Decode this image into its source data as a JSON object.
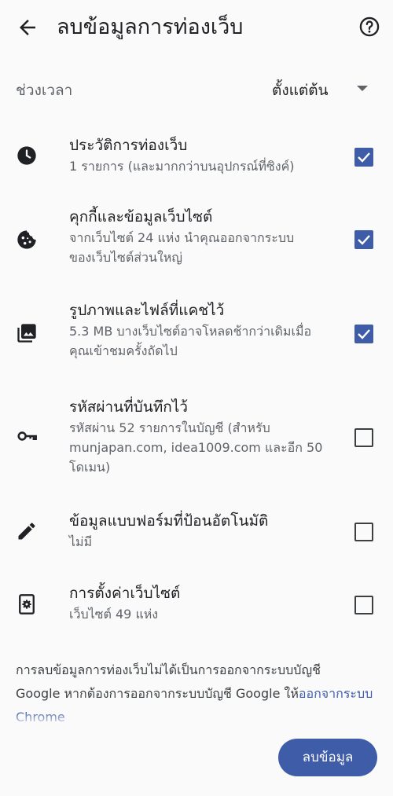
{
  "appbar": {
    "title": "ลบข้อมูลการท่องเว็บ",
    "back_icon": "arrow-back-icon",
    "help_icon": "help-circle-icon"
  },
  "time_range": {
    "label": "ช่วงเวลา",
    "value": "ตั้งแต่ต้น"
  },
  "items": [
    {
      "title": "ประวัติการท่องเว็บ",
      "subtitle": "1 รายการ (และมากกว่าบนอุปกรณ์ที่ซิงค์)",
      "icon": "clock-icon",
      "checked": true
    },
    {
      "title": "คุกกี้และข้อมูลเว็บไซต์",
      "subtitle": "จากเว็บไซต์ 24 แห่ง นำคุณออกจากระบบ\nของเว็บไซต์ส่วนใหญ่",
      "icon": "cookie-icon",
      "checked": true
    },
    {
      "title": "รูปภาพและไฟล์ที่แคชไว้",
      "subtitle": "5.3 MB บางเว็บไซต์อาจโหลดช้ากว่าเดิมเมื่อ\nคุณเข้าชมครั้งถัดไป",
      "icon": "image-icon",
      "checked": true
    },
    {
      "title": "รหัสผ่านที่บันทึกไว้",
      "subtitle": "รหัสผ่าน 52 รายการในบัญชี (สำหรับ\nmunjapan.com, idea1009.com และอีก 50\nโดเมน)",
      "icon": "key-icon",
      "checked": false
    },
    {
      "title": "ข้อมูลแบบฟอร์มที่ป้อนอัตโนมัติ",
      "subtitle": "ไม่มี",
      "icon": "pencil-icon",
      "checked": false
    },
    {
      "title": "การตั้งค่าเว็บไซต์",
      "subtitle": "เว็บไซต์ 49 แห่ง",
      "icon": "site-settings-icon",
      "checked": false
    }
  ],
  "footer": {
    "text_line1": "การลบข้อมูลการท่องเว็บไม่ได้เป็นการออกจากระบบบัญชี",
    "text_line2": "Google หากต้องการออกจากระบบบัญชี Google ให้",
    "link": "ออกจากระบบ Chrome"
  },
  "clear_button": "ลบข้อมูล",
  "colors": {
    "accent": "#3f5ca8",
    "background": "#fafafa"
  }
}
